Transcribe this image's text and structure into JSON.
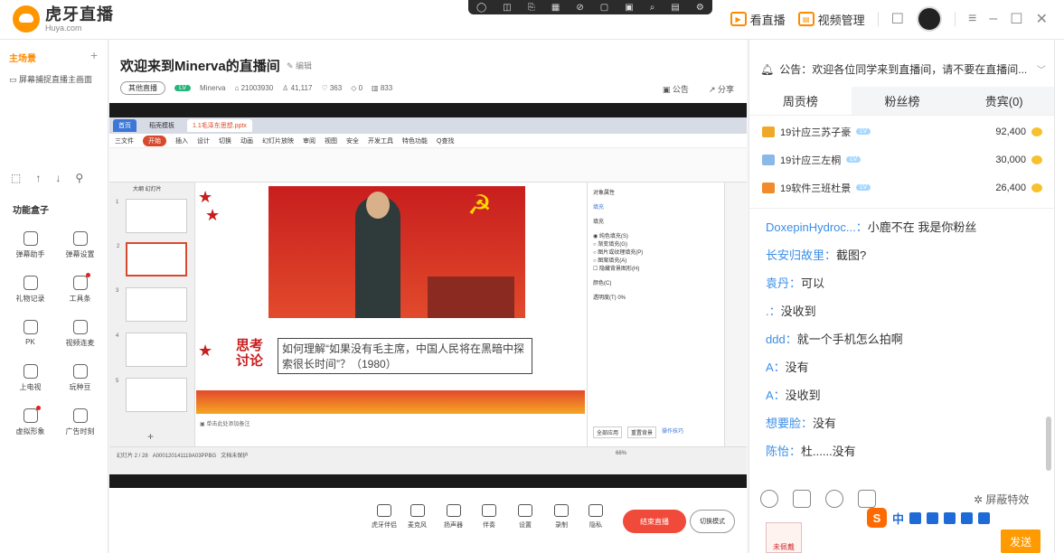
{
  "app": {
    "name_cn": "虎牙直播",
    "name_en": "Huya.com"
  },
  "topbar": {
    "watch_label": "看直播",
    "video_manage_label": "视频管理"
  },
  "left": {
    "scene_title": "主场景",
    "scene_add": "+",
    "scene_item": "屏幕捕捉直播主画面",
    "box_title": "功能盒子",
    "box_items": [
      "弹幕助手",
      "弹幕设置",
      "礼物记录",
      "工具条",
      "PK",
      "视频连麦",
      "上电视",
      "玩种豆",
      "虚拟形象",
      "广告时刻"
    ]
  },
  "room": {
    "title": "欢迎来到Minerva的直播间",
    "edit": "编辑",
    "category": "其他直播",
    "level": "LV",
    "nickname": "Minerva",
    "room_id": "21003930",
    "followers": "41,117",
    "heat": "363",
    "gift": "0",
    "views": "833",
    "notice_btn": "公告",
    "share_btn": "分享"
  },
  "wps": {
    "tab_home": "首页",
    "tab_template": "稻壳模板",
    "tab_file": "1.1毛泽东思想.pptx",
    "menu": [
      "三文件",
      "开始",
      "插入",
      "设计",
      "切换",
      "动画",
      "幻灯片放映",
      "审阅",
      "视图",
      "安全",
      "开发工具",
      "特色功能",
      "Q查找"
    ],
    "outline_tabs": "大纲  幻灯片",
    "slide_heading": "思考讨论",
    "slide_question": "如何理解“如果没有毛主席，中国人民将在黑暗中探索很长时间”？（1980）",
    "panel_title": "对象属性",
    "panel_fill": "填充",
    "panel_options": [
      "纯色填充(S)",
      "渐变填充(G)",
      "图片或纹理填充(P)",
      "图案填充(A)",
      "隐藏背景图形(H)"
    ],
    "panel_color": "颜色(C)",
    "panel_trans": "透明度(T)",
    "panel_trans_val": "0%",
    "panel_apply_all": "全部应用",
    "panel_reset": "重置背景",
    "panel_tips": "操作技巧",
    "notes_hint": "单击此处添加备注",
    "status_slide": "幻灯片 2 / 28",
    "status_doc": "A000120141119A03PPBG",
    "status_protect": "文档未保护",
    "zoom": "66%"
  },
  "bottom": {
    "tools": [
      "虎牙伴侣",
      "麦克风",
      "扬声器",
      "伴奏",
      "设置",
      "录制",
      "隐私"
    ],
    "end_live": "结束直播",
    "switch_mode": "切换模式"
  },
  "right": {
    "notice": "公告：欢迎各位同学来到直播间，请不要在直播间...",
    "tabs": [
      "周贡榜",
      "粉丝榜",
      "贵宾(0)"
    ],
    "ranks": [
      {
        "name": "19计应三苏子豪",
        "amount": "92,400",
        "medal_color": "#f0a82a"
      },
      {
        "name": "19计应三左桐",
        "amount": "30,000",
        "medal_color": "#8ab8e8"
      },
      {
        "name": "19软件三班杜景",
        "amount": "26,400",
        "medal_color": "#f08a2a"
      }
    ],
    "messages": [
      {
        "name": "DoxepinHydroc...：",
        "text": "小鹿不在 我是你粉丝"
      },
      {
        "name": "长安归故里：",
        "text": "截图?"
      },
      {
        "name": "袁丹：",
        "text": "可以"
      },
      {
        "name": ".：",
        "text": "没收到"
      },
      {
        "name": "ddd：",
        "text": "就一个手机怎么拍啊"
      },
      {
        "name": "A：",
        "text": "没有"
      },
      {
        "name": "A：",
        "text": "没收到"
      },
      {
        "name": "想要脸：",
        "text": "没有"
      },
      {
        "name": "陈怡：",
        "text": "杜......没有"
      }
    ],
    "shield_label": "屏蔽特效",
    "ime_char": "中",
    "avatar_label": "未佩戴",
    "send_label": "发送"
  }
}
